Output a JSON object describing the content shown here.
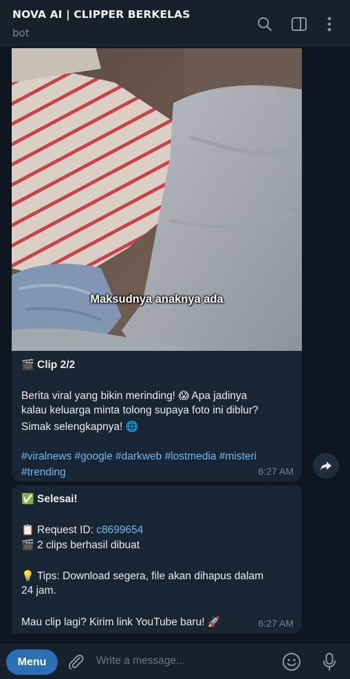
{
  "header": {
    "title": "NOVA AI | CLIPPER BERKELAS",
    "subtitle": "bot"
  },
  "messages": [
    {
      "subtitle_overlay": "Maksudnya anaknya ada",
      "clip_label": "Clip 2/2",
      "body_lines": [
        "Berita viral yang bikin merinding!",
        "Apa jadinya",
        "kalau keluarga minta tolong supaya foto ini diblur?",
        "Simak selengkapnya!"
      ],
      "hashtags_line1": [
        "#viralnews",
        "#google",
        "#darkweb",
        "#lostmedia",
        "#misteri"
      ],
      "hashtags_line2": [
        "#trending"
      ],
      "time": "6:27 AM"
    },
    {
      "status": "Selesai!",
      "request_label": "Request ID:",
      "request_id": "c8699654",
      "clips_text": "2 clips berhasil dibuat",
      "tips_line1": "Tips: Download segera, file akan dihapus dalam",
      "tips_line2": "24 jam.",
      "closing": "Mau clip lagi? Kirim link YouTube baru!",
      "time": "6:27 AM"
    }
  ],
  "composer": {
    "menu_label": "Menu",
    "placeholder": "Write a message..."
  },
  "icons": {
    "search": "search-icon",
    "sidebar": "sidebar-toggle-icon",
    "more": "more-vertical-icon",
    "share": "share-forward-icon",
    "attach": "paperclip-icon",
    "emoji": "emoji-icon",
    "mic": "microphone-icon"
  },
  "colors": {
    "background": "#0e1621",
    "header": "#17212b",
    "bubble": "#182533",
    "link": "#71baf2",
    "menu_button": "#2b6fb4"
  }
}
